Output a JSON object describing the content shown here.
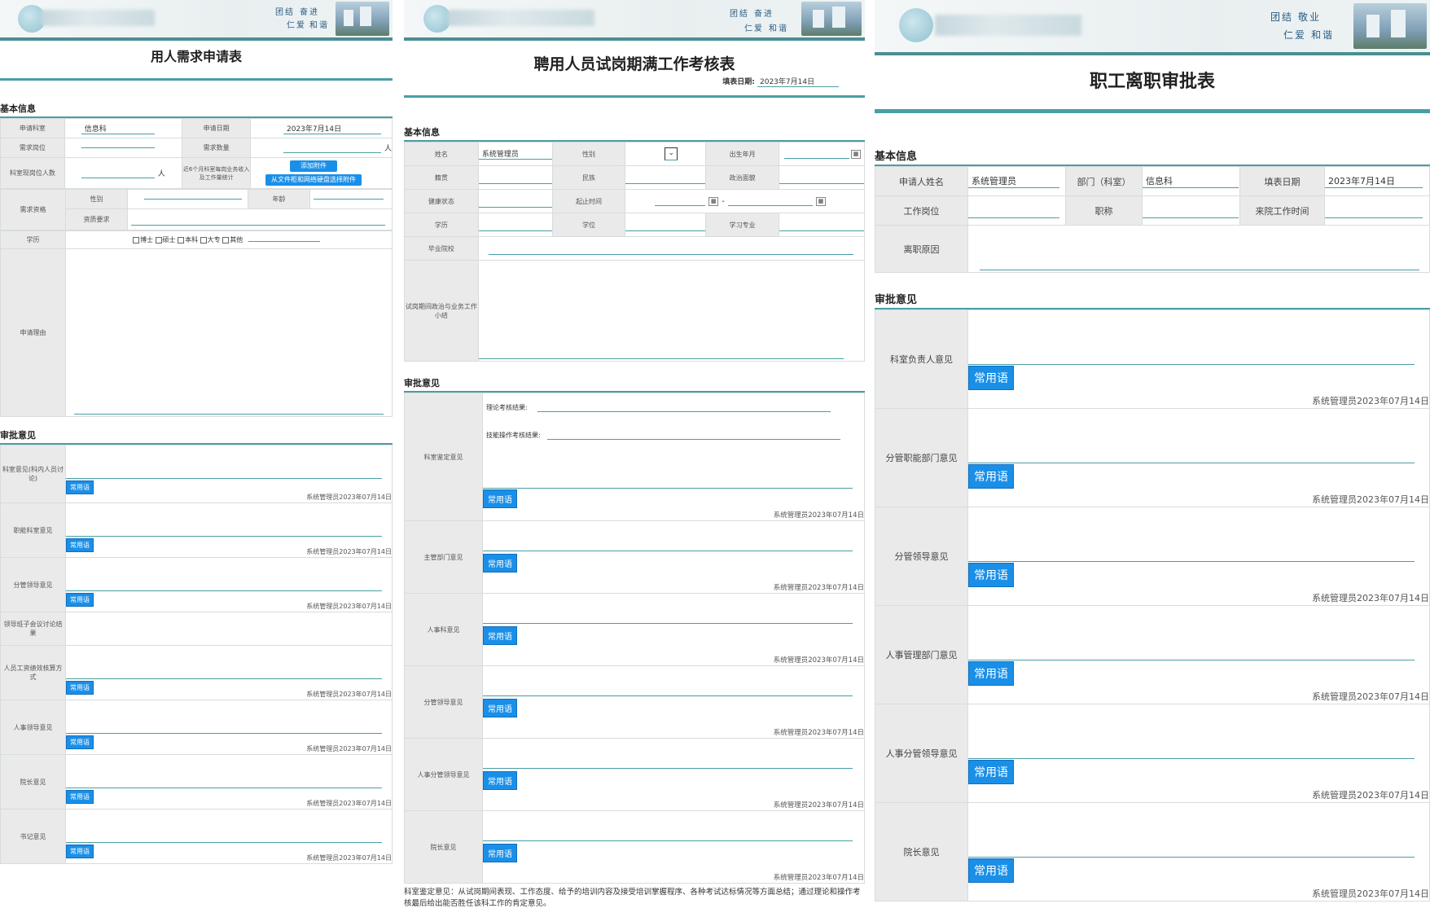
{
  "panel1": {
    "motto": [
      "团结",
      "奋进",
      "仁爱",
      "和谐"
    ],
    "title": "用人需求申请表",
    "basic_section": "基本信息",
    "rows": {
      "dept_label": "申请科室",
      "dept_value": "信息科",
      "date_label": "申请日期",
      "date_value": "2023年7月14日",
      "post_label": "需求岗位",
      "count_label": "需求数量",
      "count_unit": "人",
      "current_label": "科室现岗位人数",
      "current_unit": "人",
      "income_label": "近6个月科室每岗业务收入及工作量统计",
      "btn_add": "添加附件",
      "btn_choose": "从文件柜和网络硬盘选择附件",
      "req_label": "需求资格",
      "gender_label": "性别",
      "age_label": "年龄",
      "qual_label": "资质要求",
      "edu_label": "学历",
      "edu_options": [
        "博士",
        "硕士",
        "本科",
        "大专",
        "其他"
      ],
      "reason_label": "申请理由"
    },
    "approval_section": "审批意见",
    "approvals": [
      {
        "label": "科室意见(科内人员讨论)",
        "btn": "常用语",
        "sig": "系统管理员2023年07月14日"
      },
      {
        "label": "职能科室意见",
        "btn": "常用语",
        "sig": "系统管理员2023年07月14日"
      },
      {
        "label": "分管领导意见",
        "btn": "常用语",
        "sig": "系统管理员2023年07月14日"
      },
      {
        "label": "领导班子会议讨论结果",
        "btn": "",
        "sig": ""
      },
      {
        "label": "人员工资绩效核算方式",
        "btn": "常用语",
        "sig": "系统管理员2023年07月14日"
      },
      {
        "label": "人事领导意见",
        "btn": "常用语",
        "sig": "系统管理员2023年07月14日"
      },
      {
        "label": "院长意见",
        "btn": "常用语",
        "sig": "系统管理员2023年07月14日"
      },
      {
        "label": "书记意见",
        "btn": "常用语",
        "sig": "系统管理员2023年07月14日"
      }
    ]
  },
  "panel2": {
    "motto": [
      "团结",
      "奋进",
      "仁爱",
      "和谐"
    ],
    "title": "聘用人员试岗期满工作考核表",
    "fill_date_label": "填表日期:",
    "fill_date_value": "2023年7月14日",
    "basic_section": "基本信息",
    "rows": {
      "name_label": "姓名",
      "name_value": "系统管理员",
      "gender_label": "性别",
      "birth_label": "出生年月",
      "origin_label": "籍贯",
      "ethnic_label": "民族",
      "political_label": "政治面貌",
      "health_label": "健康状态",
      "period_label": "起止时间",
      "period_sep": "-",
      "edu_label": "学历",
      "degree_label": "学位",
      "major_label": "学习专业",
      "school_label": "毕业院校",
      "summary_label": "试岗期间政治与业务工作小结"
    },
    "approval_section": "审批意见",
    "theory_label": "理论考核结果:",
    "skill_label": "技能操作考核结果:",
    "approvals": [
      {
        "label": "科室鉴定意见",
        "btn": "常用语",
        "sig": "系统管理员2023年07月14日"
      },
      {
        "label": "主管部门意见",
        "btn": "常用语",
        "sig": "系统管理员2023年07月14日"
      },
      {
        "label": "人事科意见",
        "btn": "常用语",
        "sig": "系统管理员2023年07月14日"
      },
      {
        "label": "分管领导意见",
        "btn": "常用语",
        "sig": "系统管理员2023年07月14日"
      },
      {
        "label": "人事分管领导意见",
        "btn": "常用语",
        "sig": "系统管理员2023年07月14日"
      },
      {
        "label": "院长意见",
        "btn": "常用语",
        "sig": "系统管理员2023年07月14日"
      }
    ],
    "footnote": "科室鉴定意见：从试岗期间表现、工作态度、给予的培训内容及接受培训掌握程序、各种考试达标情况等方面总结；通过理论和操作考核最后给出能否胜任该科工作的肯定意见。"
  },
  "panel3": {
    "motto": [
      "团结",
      "敬业",
      "仁爱",
      "和谐"
    ],
    "title": "职工离职审批表",
    "basic_section": "基本信息",
    "rows": {
      "applicant_label": "申请人姓名",
      "applicant_value": "系统管理员",
      "dept_label": "部门（科室）",
      "dept_value": "信息科",
      "date_label": "填表日期",
      "date_value": "2023年7月14日",
      "post_label": "工作岗位",
      "title_label": "职称",
      "join_label": "来院工作时间",
      "reason_label": "离职原因"
    },
    "approval_section": "审批意见",
    "approvals": [
      {
        "label": "科室负责人意见",
        "btn": "常用语",
        "sig": "系统管理员2023年07月14日"
      },
      {
        "label": "分管职能部门意见",
        "btn": "常用语",
        "sig": "系统管理员2023年07月14日"
      },
      {
        "label": "分管领导意见",
        "btn": "常用语",
        "sig": "系统管理员2023年07月14日"
      },
      {
        "label": "人事管理部门意见",
        "btn": "常用语",
        "sig": "系统管理员2023年07月14日"
      },
      {
        "label": "人事分管领导意见",
        "btn": "常用语",
        "sig": "系统管理员2023年07月14日"
      },
      {
        "label": "院长意见",
        "btn": "常用语",
        "sig": "系统管理员2023年07月14日"
      }
    ]
  }
}
